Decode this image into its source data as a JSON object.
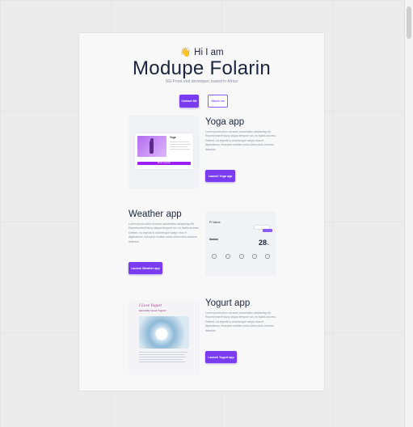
{
  "hero": {
    "wave_emoji": "👋",
    "greeting": "Hi I am",
    "name": "Modupe Folarin",
    "tagline": "NG Front end developer, based in Africa",
    "contact_label": "Contact Me",
    "secondary_label": "About me"
  },
  "projects": [
    {
      "title": "Yoga app",
      "description": "Lorem ipsum dolor sit amet consectetur adipiscing elit. Reprehenderit fauny aliqua tempore ion, ex facilis dolores. Deferet, ea impedit si doloremque saepe eius et dignissimos, excepturi molitae untos ultrica duis dolorem delectus",
      "button_label": "Launch Yoga app",
      "thumb": {
        "heading": "Yoga",
        "bar_label": "Book a session"
      }
    },
    {
      "title": "Weather app",
      "description": "Lorem ipsum dolor sit amet consectetur adipiscing elit. Reprehenderit fauny aliqua tempore ion, ex facilis dolores. Deferet, ea impedit si doloremque saepe eius et dignissimos, excepturi molitae untos ultrica duis dolorem delectus",
      "button_label": "Launch Weather app",
      "thumb": {
        "heading": "Pr Nature",
        "city": "Ibadan",
        "temp": "28",
        "unit": "°c"
      }
    },
    {
      "title": "Yogurt app",
      "description": "Lorem ipsum dolor sit amet consectetur adipiscing elit. Reprehenderit fauny aliqua tempore ion, ex facilis dolores. Deferet, ea impedit si doloremque saepe eius et dignissimos, excepturi molitae untos ultrica duis dolorem delectus",
      "button_label": "Launch Yogurt app",
      "thumb": {
        "heading": "I Love Yogurt",
        "subheading": "Especially Greek Yogurts"
      }
    }
  ],
  "colors": {
    "accent": "#7a3cf0",
    "text": "#1c2540",
    "muted": "#8b90a3"
  }
}
